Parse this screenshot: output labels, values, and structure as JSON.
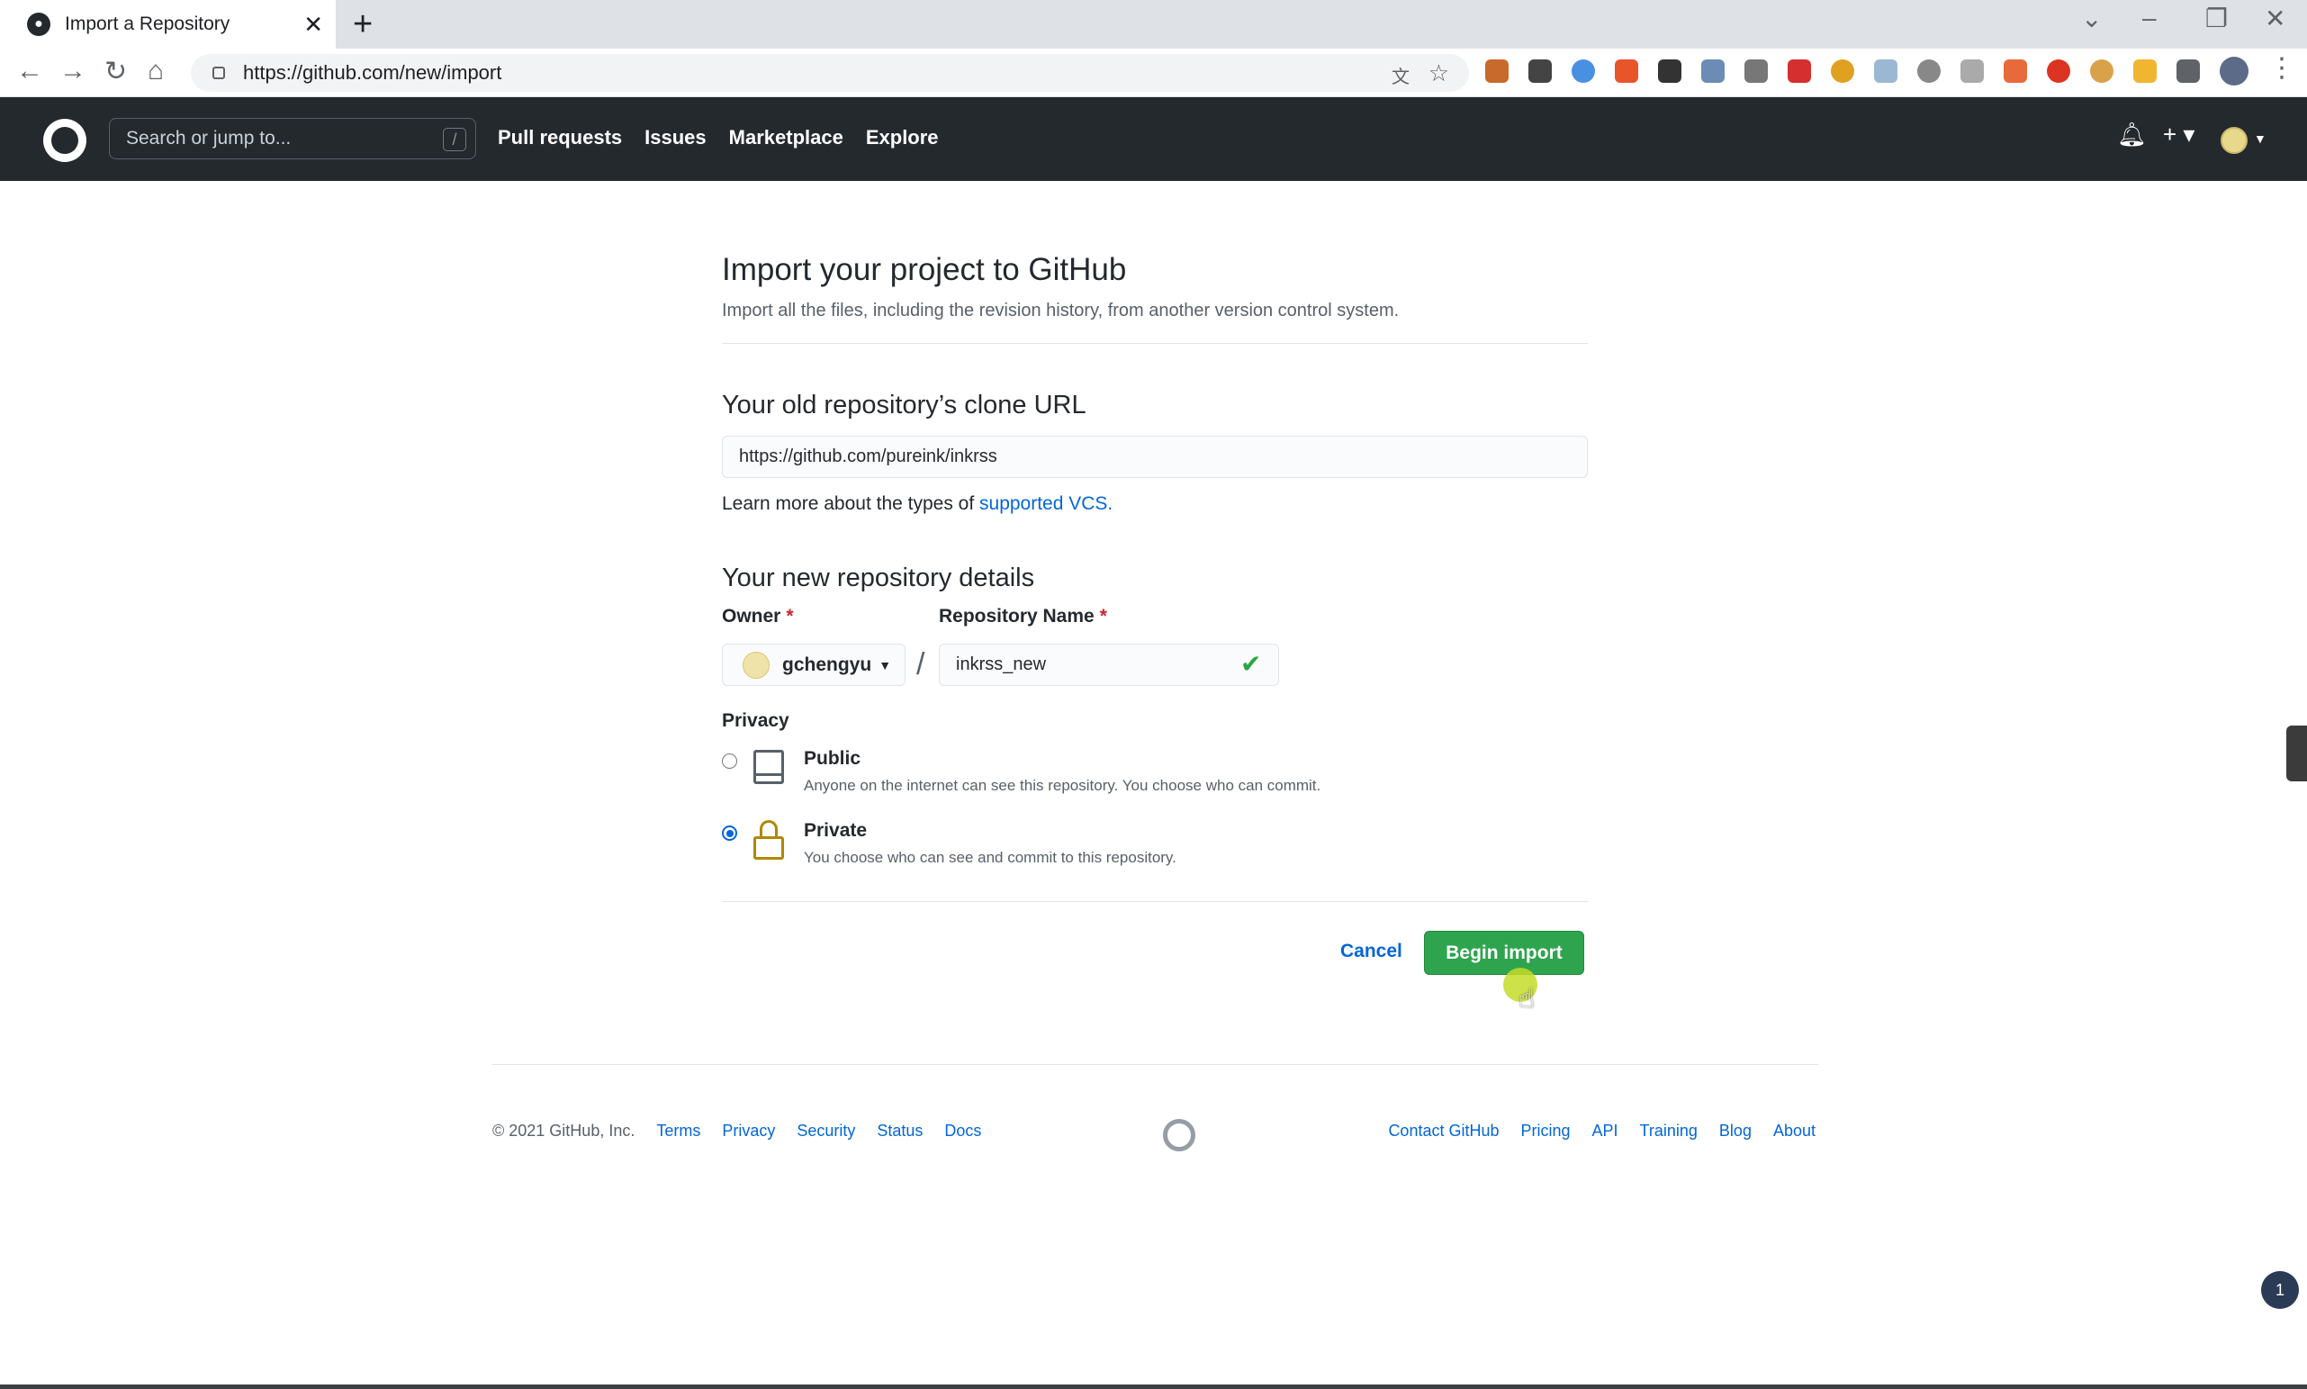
{
  "browser": {
    "tab_title": "Import a Repository",
    "url": "https://github.com/new/import"
  },
  "header": {
    "search_placeholder": "Search or jump to...",
    "search_shortcut": "/",
    "nav": [
      "Pull requests",
      "Issues",
      "Marketplace",
      "Explore"
    ]
  },
  "main": {
    "title": "Import your project to GitHub",
    "subtitle": "Import all the files, including the revision history, from another version control system.",
    "clone_heading": "Your old repository’s clone URL",
    "clone_url": "https://github.com/pureink/inkrss",
    "hint_prefix": "Learn more about the types of ",
    "hint_link": "supported VCS.",
    "details_heading": "Your new repository details",
    "owner_label": "Owner",
    "owner_value": "gchengyu",
    "repo_label": "Repository Name",
    "repo_value": "inkrss_new",
    "required_mark": "*",
    "separator": "/",
    "privacy_label": "Privacy",
    "public_title": "Public",
    "public_desc": "Anyone on the internet can see this repository. You choose who can commit.",
    "private_title": "Private",
    "private_desc": "You choose who can see and commit to this repository.",
    "selected_privacy": "Private",
    "cancel_label": "Cancel",
    "begin_label": "Begin import"
  },
  "footer": {
    "copyright": "© 2021 GitHub, Inc.",
    "left_links": [
      "Terms",
      "Privacy",
      "Security",
      "Status",
      "Docs"
    ],
    "right_links": [
      "Contact GitHub",
      "Pricing",
      "API",
      "Training",
      "Blog",
      "About"
    ]
  },
  "notification_count": "1",
  "colors": {
    "header_bg": "#24292e",
    "primary_button": "#2ea44f",
    "link": "#0366d6",
    "success_check": "#28a745"
  }
}
